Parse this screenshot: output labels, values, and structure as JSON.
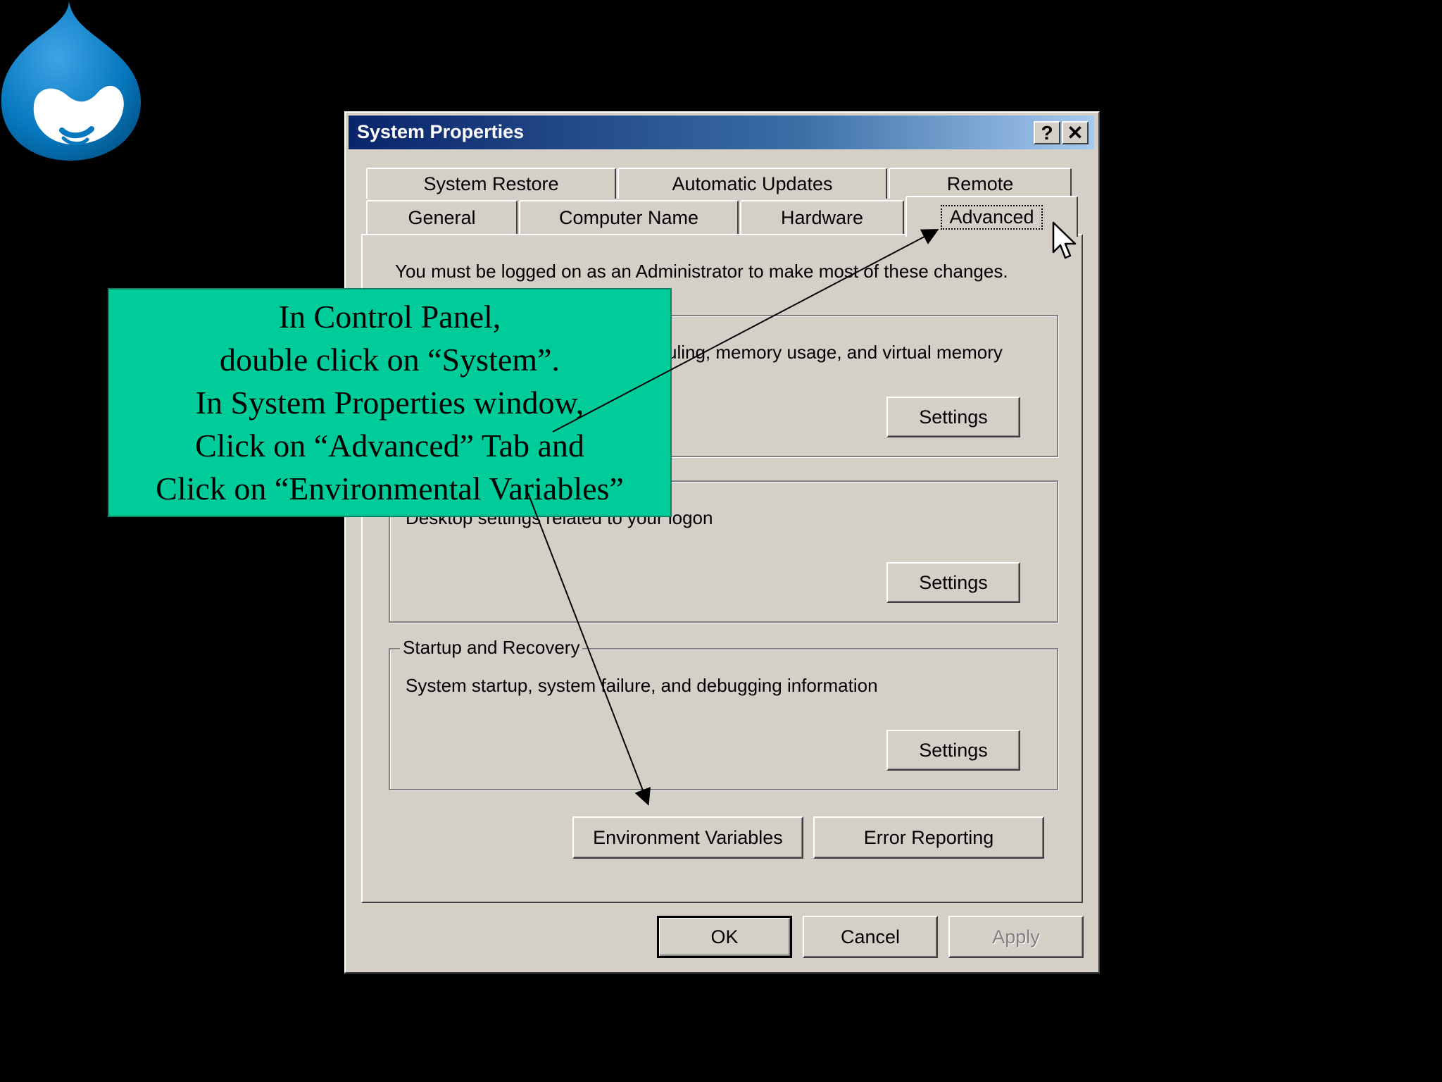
{
  "window": {
    "title": "System Properties",
    "help_button": "?",
    "close_button": "✕"
  },
  "tabs": {
    "row1": [
      "System Restore",
      "Automatic Updates",
      "Remote"
    ],
    "row2": [
      "General",
      "Computer Name",
      "Hardware",
      "Advanced"
    ],
    "active": "Advanced"
  },
  "advanced": {
    "admin_notice": "You must be logged on as an Administrator to make most of these changes.",
    "performance": {
      "description_visible": "uling, memory usage, and virtual memory",
      "settings_label": "Settings"
    },
    "user_profiles": {
      "description_visible": "Desktop settings related to your logon",
      "settings_label": "Settings"
    },
    "startup_recovery": {
      "legend": "Startup and Recovery",
      "description": "System startup, system failure, and debugging information",
      "settings_label": "Settings"
    },
    "env_vars_label": "Environment Variables",
    "error_reporting_label": "Error Reporting"
  },
  "footer": {
    "ok_label": "OK",
    "cancel_label": "Cancel",
    "apply_label": "Apply"
  },
  "callout": {
    "lines": [
      "In Control Panel,",
      "double click on “System”.",
      "In System Properties window,",
      "Click on “Advanced” Tab and",
      "Click on “Environmental Variables”"
    ]
  },
  "colors": {
    "callout_bg": "#00cc99",
    "titlebar_start": "#0a246a",
    "titlebar_end": "#a6caf0",
    "logo_blue": "#0678be"
  },
  "icons": {
    "logo": "drupal-drop-icon",
    "cursor": "mouse-pointer-icon"
  }
}
